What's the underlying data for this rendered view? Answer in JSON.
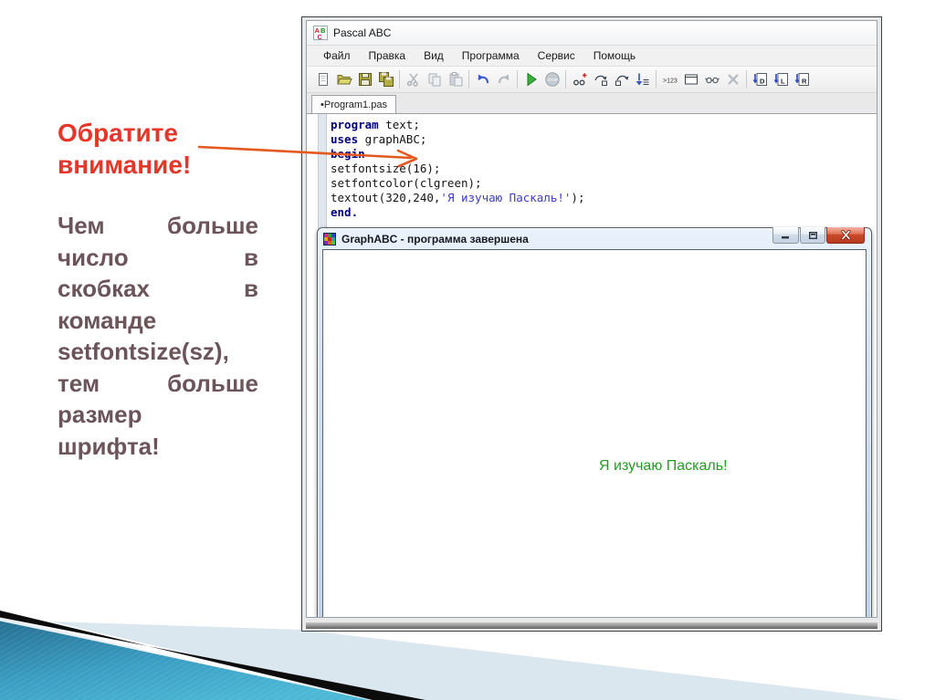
{
  "slide": {
    "heading_lines": [
      "Обратите",
      "внимание!"
    ],
    "body_lines": [
      "Чем больше",
      "число в",
      "скобках в",
      "команде",
      "setfontsize(sz),",
      "тем больше",
      "размер",
      "шрифта!"
    ],
    "colors": {
      "heading": "#e63529",
      "body": "#6c545b",
      "arrow": "#e3591f",
      "teal_dark": "#256f92",
      "teal_light": "#4cb8d6",
      "pale_band": "#dbe7ee",
      "black_stripe": "#0c0c0c"
    }
  },
  "ide": {
    "window_title": "Pascal ABC",
    "app_icon": "pascal-abc-logo-icon",
    "menu": [
      "Файл",
      "Правка",
      "Вид",
      "Программа",
      "Сервис",
      "Помощь"
    ],
    "toolbar_buttons": [
      {
        "name": "new-file-button",
        "kind": "page",
        "disabled": false
      },
      {
        "name": "open-file-button",
        "kind": "folder",
        "disabled": false
      },
      {
        "name": "save-button",
        "kind": "disk",
        "disabled": false
      },
      {
        "name": "save-all-button",
        "kind": "disks",
        "disabled": false
      },
      {
        "name": "separator",
        "kind": "sep"
      },
      {
        "name": "cut-button",
        "kind": "scissors",
        "disabled": true
      },
      {
        "name": "copy-button",
        "kind": "copy",
        "disabled": true
      },
      {
        "name": "paste-button",
        "kind": "paste",
        "disabled": true
      },
      {
        "name": "separator",
        "kind": "sep"
      },
      {
        "name": "undo-button",
        "kind": "undo",
        "disabled": false
      },
      {
        "name": "redo-button",
        "kind": "redo",
        "disabled": true
      },
      {
        "name": "separator",
        "kind": "sep"
      },
      {
        "name": "run-button",
        "kind": "play",
        "disabled": false
      },
      {
        "name": "stop-button",
        "kind": "stop",
        "glyph": "STOP",
        "disabled": true
      },
      {
        "name": "separator",
        "kind": "sep"
      },
      {
        "name": "trace-button",
        "kind": "trace",
        "disabled": false
      },
      {
        "name": "step-over-button",
        "kind": "stepover",
        "disabled": false
      },
      {
        "name": "step-out-button",
        "kind": "stepout",
        "disabled": false
      },
      {
        "name": "goto-line-button",
        "kind": "gotoline",
        "disabled": false
      },
      {
        "name": "separator",
        "kind": "sep"
      },
      {
        "name": "int-format-button",
        "kind": "n123",
        "glyph": ">123",
        "disabled": false
      },
      {
        "name": "new-window-button",
        "kind": "window",
        "disabled": false
      },
      {
        "name": "expression-watch-button",
        "kind": "watch",
        "disabled": false
      },
      {
        "name": "close-file-button",
        "kind": "closex",
        "disabled": true
      },
      {
        "name": "separator",
        "kind": "sep"
      },
      {
        "name": "output-d-button",
        "kind": "modpage",
        "glyph": "D",
        "disabled": false
      },
      {
        "name": "output-l-button",
        "kind": "modpage",
        "glyph": "L",
        "disabled": false
      },
      {
        "name": "output-r-button",
        "kind": "modpage",
        "glyph": "R",
        "disabled": false
      }
    ],
    "tab_label": "•Program1.pas",
    "code_lines": [
      [
        {
          "t": "program",
          "k": "kw"
        },
        {
          "t": " text;",
          "k": "pl"
        }
      ],
      [
        {
          "t": "uses",
          "k": "kw"
        },
        {
          "t": " graphABC;",
          "k": "pl"
        }
      ],
      [
        {
          "t": "begin",
          "k": "kw"
        }
      ],
      [
        {
          "t": "setfontsize(16);",
          "k": "pl"
        }
      ],
      [
        {
          "t": "setfontcolor(clgreen);",
          "k": "pl"
        }
      ],
      [
        {
          "t": "textout(320,240,",
          "k": "pl"
        },
        {
          "t": "'Я изучаю Паскаль!'",
          "k": "str"
        },
        {
          "t": ");",
          "k": "pl"
        }
      ],
      [
        {
          "t": "end.",
          "k": "kw"
        }
      ]
    ]
  },
  "graph_window": {
    "icon": "graphabc-palette-icon",
    "title": "GraphABC - программа завершена",
    "caption_buttons": [
      "minimize-button",
      "restore-button",
      "close-button"
    ],
    "output_text": "Я изучаю Паскаль!",
    "output_color": "#1f9e1f"
  }
}
